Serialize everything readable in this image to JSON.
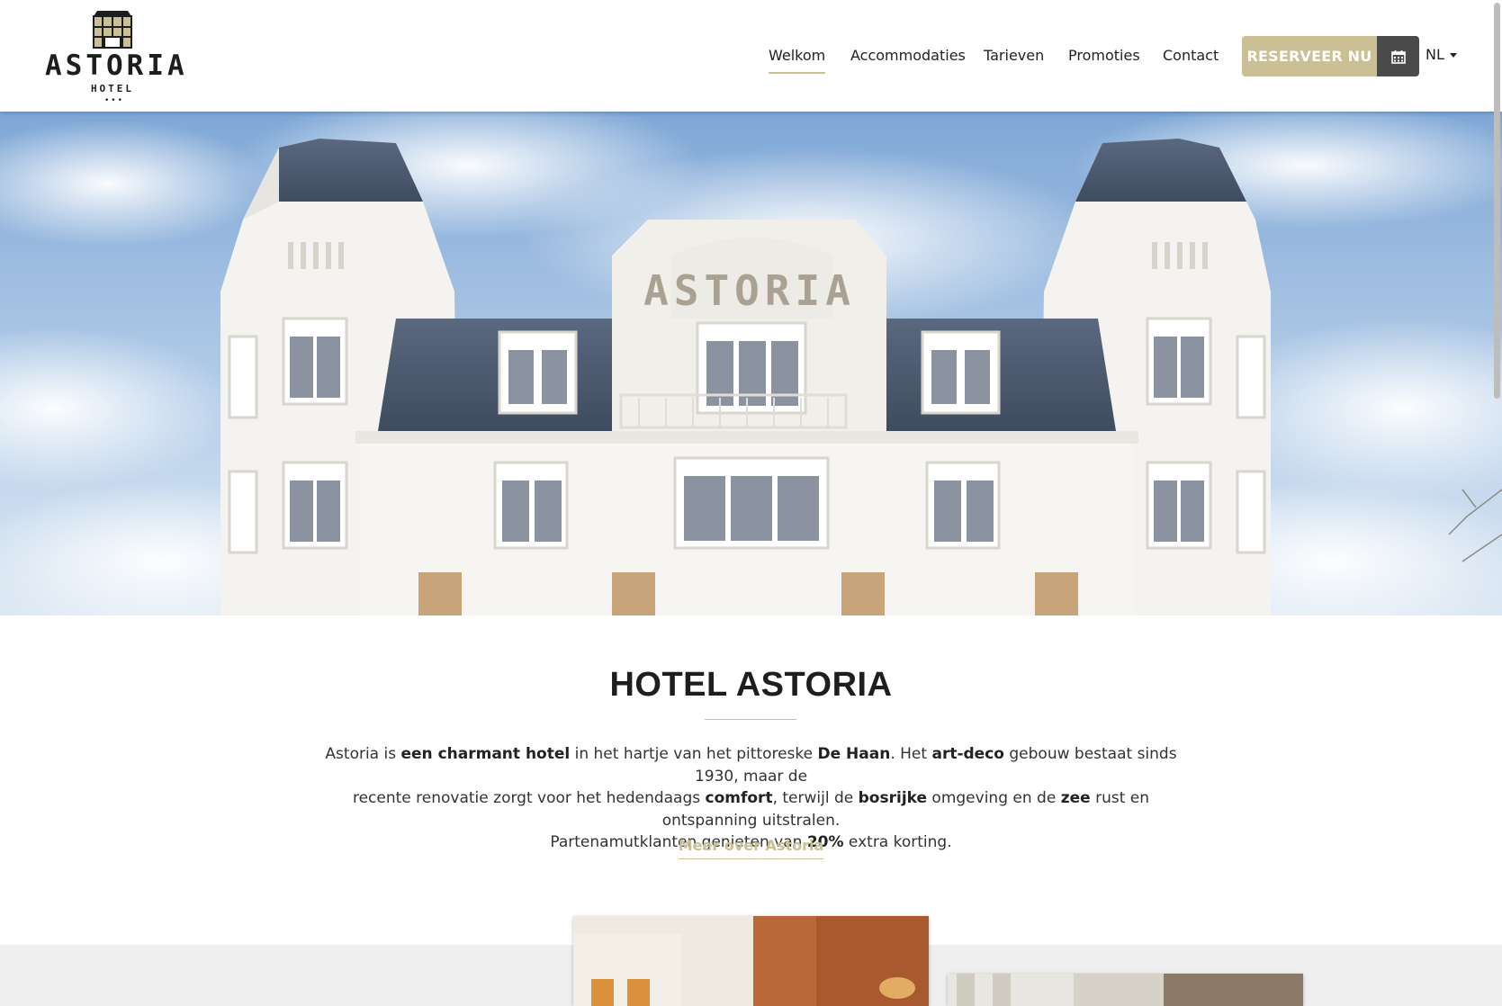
{
  "brand": {
    "name": "ASTORIA",
    "sub": "HOTEL",
    "dots": "•••",
    "accent_color": "#cbbf95",
    "dark_color": "#4a4a4a"
  },
  "nav": {
    "items": [
      {
        "label": "Welkom",
        "active": true
      },
      {
        "label": "Accommodaties",
        "active": false
      },
      {
        "label": "Tarieven",
        "active": false
      },
      {
        "label": "Promoties",
        "active": false
      },
      {
        "label": "Contact",
        "active": false
      }
    ],
    "reserve_label": "RESERVEER NU",
    "calendar_icon": "calendar-icon",
    "language": "NL"
  },
  "hero": {
    "image": "hotel-facade-photo",
    "facade_text": "ASTORIA"
  },
  "intro": {
    "title": "HOTEL ASTORIA",
    "line1": [
      {
        "t": "Astoria is ",
        "b": false
      },
      {
        "t": "een charmant hotel",
        "b": true
      },
      {
        "t": " in het hartje van het pittoreske ",
        "b": false
      },
      {
        "t": "De Haan",
        "b": true
      },
      {
        "t": ". Het ",
        "b": false
      },
      {
        "t": "art-deco",
        "b": true
      },
      {
        "t": " gebouw bestaat sinds 1930, maar de",
        "b": false
      }
    ],
    "line2": [
      {
        "t": "recente renovatie zorgt voor het hedendaags ",
        "b": false
      },
      {
        "t": "comfort",
        "b": true
      },
      {
        "t": ", terwijl de ",
        "b": false
      },
      {
        "t": "bosrijke",
        "b": true
      },
      {
        "t": " omgeving en de ",
        "b": false
      },
      {
        "t": "zee",
        "b": true
      },
      {
        "t": " rust en ontspanning uitstralen.",
        "b": false
      }
    ],
    "line3": [
      {
        "t": "Partenamutklanten genieten van ",
        "b": false
      },
      {
        "t": "20%",
        "b": true
      },
      {
        "t": " extra korting.",
        "b": false
      }
    ],
    "more_link": "Meer over Astoria"
  }
}
